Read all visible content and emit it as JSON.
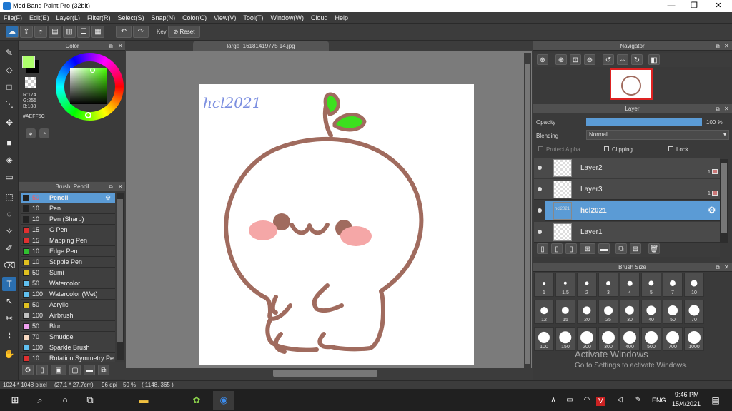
{
  "window": {
    "title": "MediBang Paint Pro (32bit)",
    "minimize": "—",
    "restore": "❐",
    "close": "✕"
  },
  "menu": [
    "File(F)",
    "Edit(E)",
    "Layer(L)",
    "Filter(R)",
    "Select(S)",
    "Snap(N)",
    "Color(C)",
    "View(V)",
    "Tool(T)",
    "Window(W)",
    "Cloud",
    "Help"
  ],
  "toolbar": {
    "key_label": "Key",
    "reset_label": "Reset"
  },
  "color_panel": {
    "title": "Color",
    "r": "R:174",
    "g": "G:255",
    "b": "B:108",
    "hex": "#AEFF6C",
    "fg_color": "#AEFF6C",
    "bg_color": "#000000"
  },
  "brush_panel": {
    "title": "Brush: Pencil",
    "items": [
      {
        "size": "50",
        "name": "Pencil",
        "color": "#222222",
        "selected": true
      },
      {
        "size": "10",
        "name": "Pen",
        "color": "#222222"
      },
      {
        "size": "10",
        "name": "Pen (Sharp)",
        "color": "#222222"
      },
      {
        "size": "15",
        "name": "G Pen",
        "color": "#e03030"
      },
      {
        "size": "15",
        "name": "Mapping Pen",
        "color": "#e03030"
      },
      {
        "size": "10",
        "name": "Edge Pen",
        "color": "#30c030"
      },
      {
        "size": "10",
        "name": "Stipple Pen",
        "color": "#e0c020"
      },
      {
        "size": "50",
        "name": "Sumi",
        "color": "#e0c020"
      },
      {
        "size": "50",
        "name": "Watercolor",
        "color": "#60c0f0"
      },
      {
        "size": "100",
        "name": "Watercolor (Wet)",
        "color": "#60c0f0"
      },
      {
        "size": "50",
        "name": "Acrylic",
        "color": "#e0c020"
      },
      {
        "size": "100",
        "name": "Airbrush",
        "color": "#c0c0c0"
      },
      {
        "size": "50",
        "name": "Blur",
        "color": "#f0a0f0"
      },
      {
        "size": "70",
        "name": "Smudge",
        "color": "#f8d8c0"
      },
      {
        "size": "100",
        "name": "Sparkle Brush",
        "color": "#60c0f0"
      },
      {
        "size": "10",
        "name": "Rotation Symmetry Pe",
        "color": "#e03030"
      }
    ]
  },
  "canvas": {
    "tab_title": "large_16181419775 14.jpg",
    "watermark_text": "hcl2021"
  },
  "navigator": {
    "title": "Navigator"
  },
  "layer_panel": {
    "title": "Layer",
    "opacity_label": "Opacity",
    "opacity_value": "100 %",
    "opacity_fraction": 1.0,
    "blending_label": "Blending",
    "blending_value": "Normal",
    "protect_alpha": "Protect Alpha",
    "clipping": "Clipping",
    "lock": "Lock",
    "layers": [
      {
        "name": "Layer2",
        "badge": "1",
        "selected": false
      },
      {
        "name": "Layer3",
        "badge": "1",
        "selected": false
      },
      {
        "name": "hcl2021",
        "badge": "",
        "selected": true,
        "thumb_text": "hcl2021"
      },
      {
        "name": "Layer1",
        "badge": "",
        "selected": false
      }
    ]
  },
  "brush_size": {
    "title": "Brush Size",
    "sizes": [
      "1",
      "1.5",
      "2",
      "3",
      "4",
      "5",
      "7",
      "10",
      "12",
      "15",
      "20",
      "25",
      "30",
      "40",
      "50",
      "70",
      "100",
      "150",
      "200",
      "300",
      "400",
      "500",
      "700",
      "1000"
    ]
  },
  "activation": {
    "line1": "Activate Windows",
    "line2": "Go to Settings to activate Windows."
  },
  "status": {
    "dims": "1024 * 1048 pixel",
    "size": "(27.1 * 27.7cm)",
    "dpi": "96 dpi",
    "zoom": "50 %",
    "coords": "( 1148, 365 )"
  },
  "taskbar": {
    "time": "9:46 PM",
    "date": "15/4/2021",
    "lang": "ENG"
  }
}
